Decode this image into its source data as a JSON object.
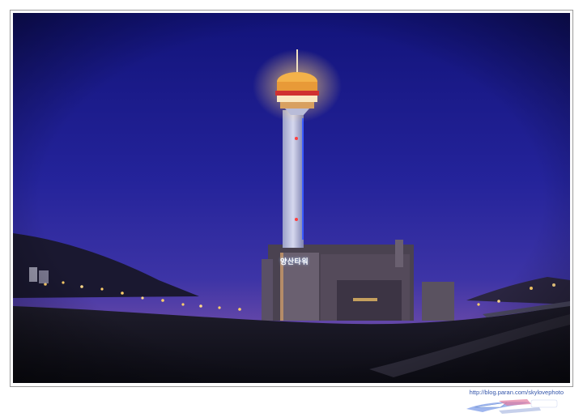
{
  "photo": {
    "subject": "illuminated observation tower at dusk",
    "sign_text": "양산타워",
    "colors": {
      "sky_top": "#12137a",
      "sky_mid": "#2e2a9c",
      "horizon": "#6a4aa8",
      "tower_light": "#f3b24a"
    }
  },
  "watermark": {
    "url": "http://blog.paran.com/skylovephoto",
    "logo_text": "Paran"
  }
}
